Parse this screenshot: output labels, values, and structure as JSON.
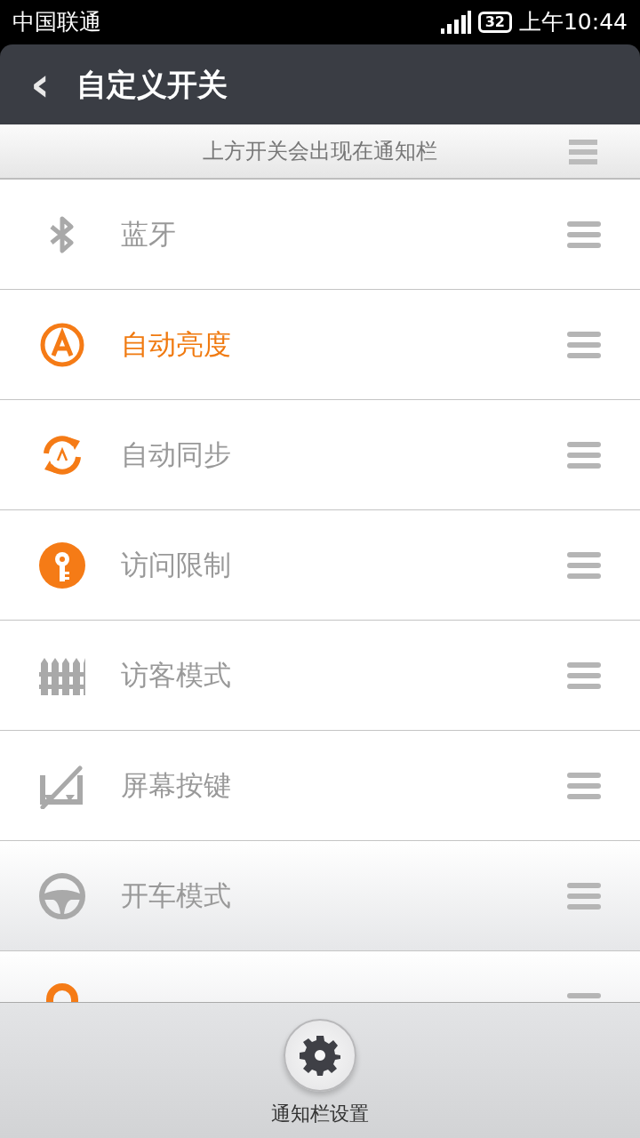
{
  "status_bar": {
    "carrier": "中国联通",
    "battery": "32",
    "time": "上午10:44"
  },
  "header": {
    "back": "‹",
    "title": "自定义开关"
  },
  "section": {
    "title": "上方开关会出现在通知栏"
  },
  "toggles": [
    {
      "kind": "bluetooth",
      "label": "蓝牙",
      "on": false,
      "selected": false
    },
    {
      "kind": "brightness",
      "label": "自动亮度",
      "on": true,
      "selected": true
    },
    {
      "kind": "sync",
      "label": "自动同步",
      "on": true,
      "selected": false
    },
    {
      "kind": "key",
      "label": "访问限制",
      "on": true,
      "selected": false
    },
    {
      "kind": "fence",
      "label": "访客模式",
      "on": false,
      "selected": false
    },
    {
      "kind": "buttons",
      "label": "屏幕按键",
      "on": false,
      "selected": false
    },
    {
      "kind": "wheel",
      "label": "开车模式",
      "on": false,
      "selected": false
    },
    {
      "kind": "lock",
      "on": true
    }
  ],
  "bottom_button": {
    "label": "通知栏设置"
  }
}
